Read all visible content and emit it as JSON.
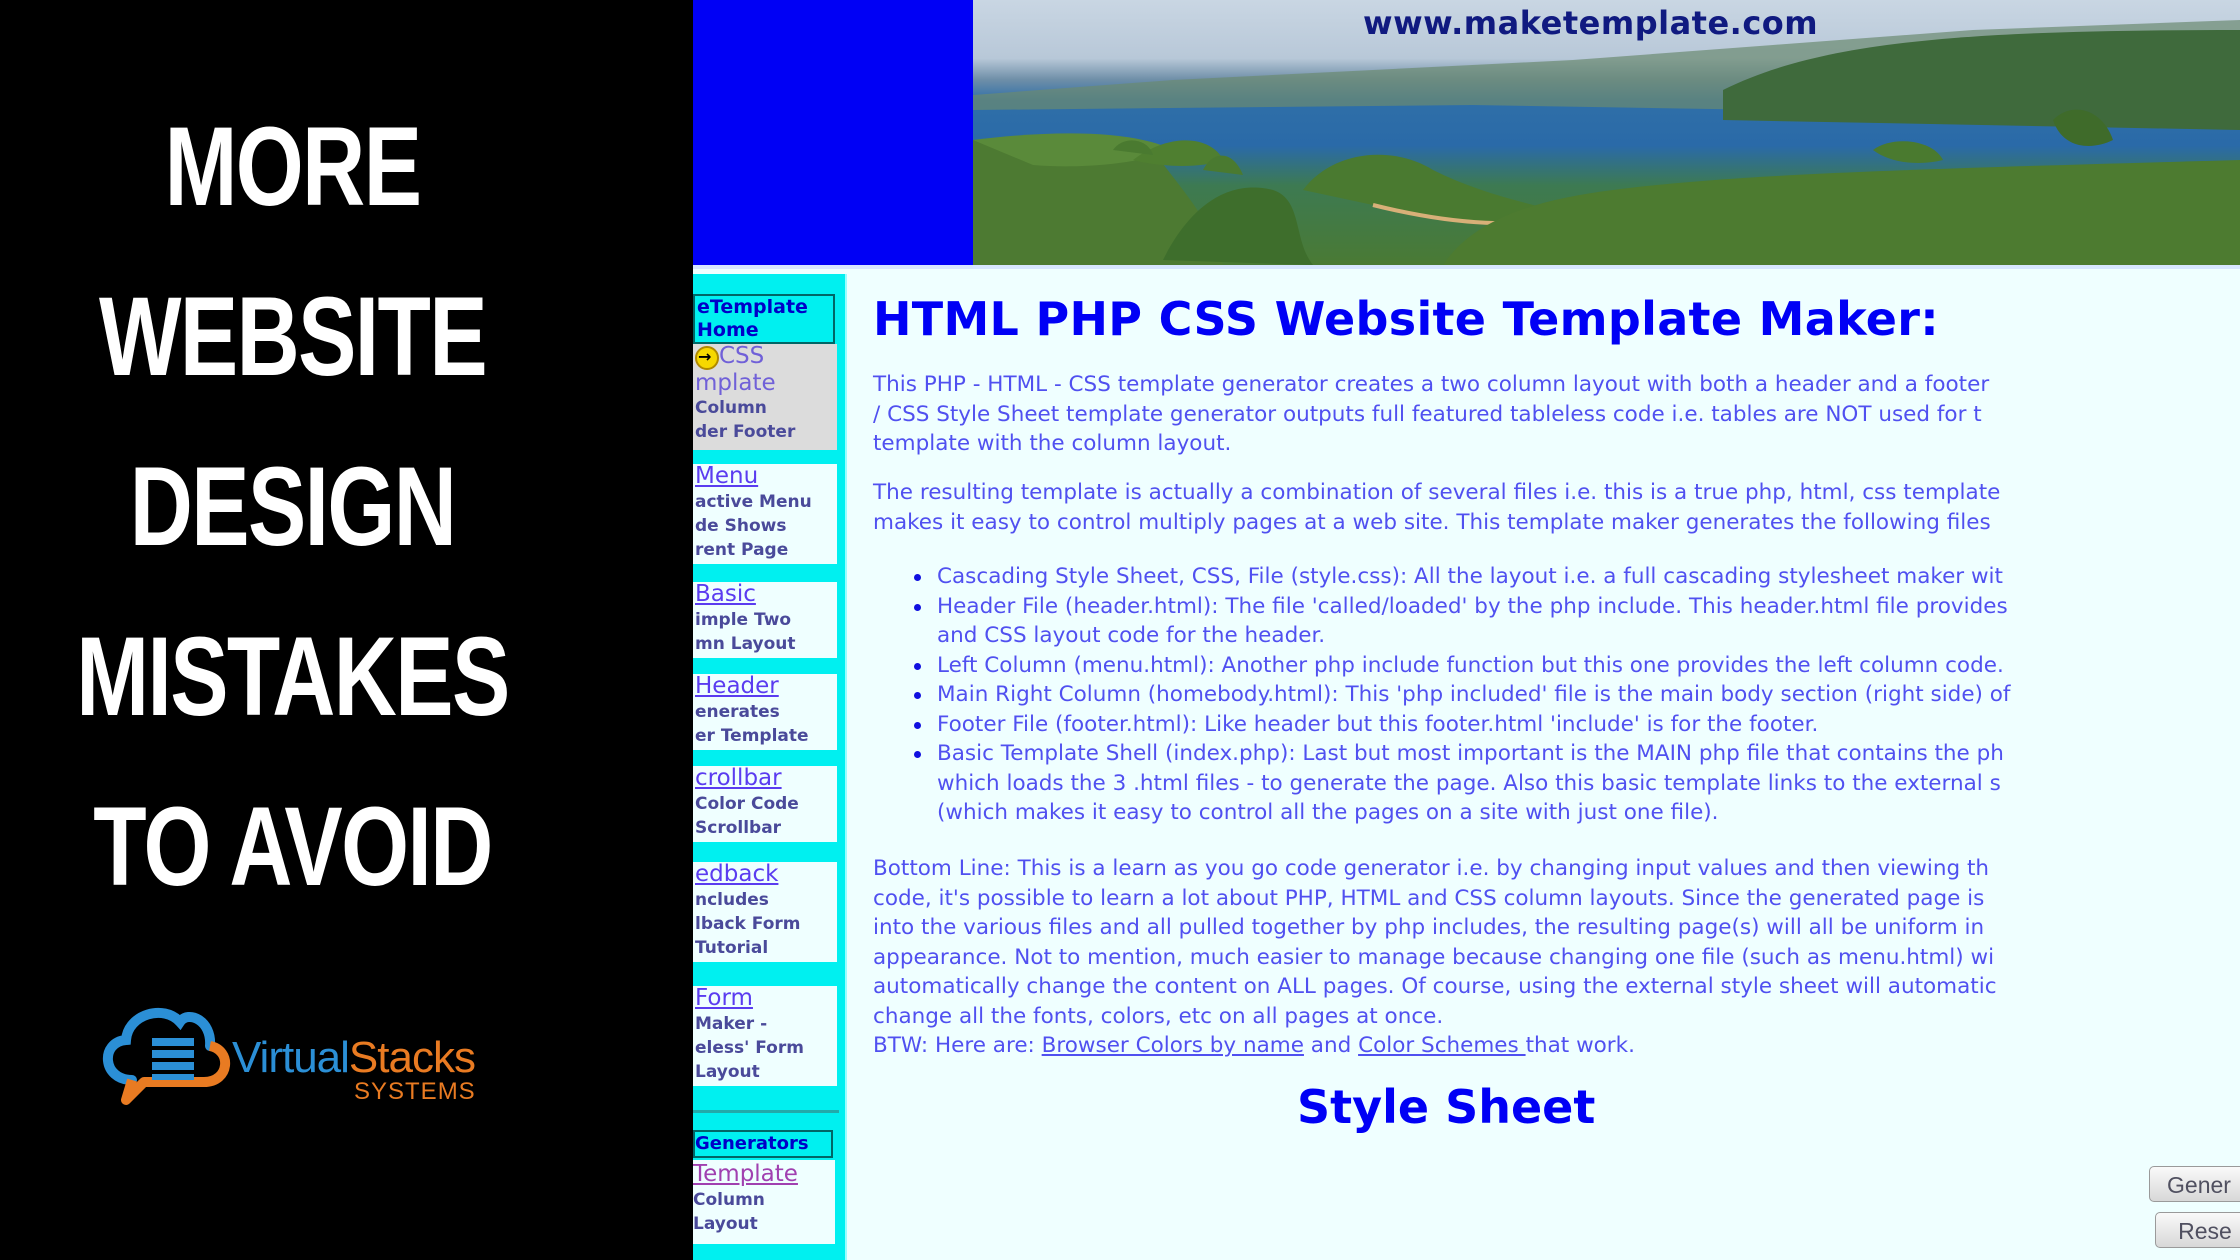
{
  "promo": {
    "title_lines": [
      "MORE",
      "WEBSITE",
      "DESIGN",
      "MISTAKES",
      "TO AVOID"
    ],
    "logo": {
      "word1": "Virtual",
      "word2": "Stacks",
      "sub": "SYSTEMS"
    },
    "colors": {
      "blue": "#2b8fd6",
      "orange": "#e97b22"
    }
  },
  "site": {
    "banner_url": "www.maketemplate.com",
    "sidebar": {
      "header": [
        "eTemplate",
        "Home"
      ],
      "items": [
        {
          "link": "CSS",
          "link2": "mplate",
          "desc": [
            "Column",
            "der Footer"
          ],
          "active": true
        },
        {
          "link": "Menu",
          "desc": [
            "active Menu",
            "de Shows",
            "rent Page"
          ]
        },
        {
          "link": "Basic",
          "desc": [
            "imple Two",
            "mn Layout"
          ]
        },
        {
          "link": "Header",
          "desc": [
            "enerates",
            "er Template"
          ]
        },
        {
          "link": "crollbar",
          "desc": [
            "Color Code",
            "Scrollbar"
          ]
        },
        {
          "link": "edback",
          "desc": [
            "ncludes",
            "lback Form",
            "Tutorial"
          ]
        },
        {
          "link": "Form",
          "desc": [
            "Maker -",
            "eless' Form",
            "Layout"
          ]
        }
      ],
      "generators_header": "Generators",
      "generators_item": {
        "link": "Template",
        "desc": [
          "Column",
          "Layout"
        ]
      }
    },
    "main": {
      "title": "HTML PHP CSS Website Template Maker:",
      "intro_lines": [
        "This PHP - HTML - CSS template generator creates a two column layout with both a header and a footer",
        "/ CSS Style Sheet template generator outputs full featured tableless code i.e. tables are NOT used for t",
        "template with the column layout."
      ],
      "files_lines": [
        "The resulting template is actually a combination of several files i.e. this is a true php, html, css template",
        "makes it easy to control multiply pages at a web site. This template maker generates the following files"
      ],
      "bullets": [
        [
          "Cascading Style Sheet, CSS, File (style.css): All the layout i.e. a full cascading stylesheet maker wit"
        ],
        [
          "Header File (header.html): The file 'called/loaded' by the php include. This header.html file provides",
          "and CSS layout code for the header."
        ],
        [
          "Left Column (menu.html): Another php include function but this one provides the left column code."
        ],
        [
          "Main Right Column (homebody.html): This 'php included' file is the main body section (right side) of"
        ],
        [
          "Footer File (footer.html): Like header but this footer.html 'include' is for the footer."
        ],
        [
          "Basic Template Shell (index.php): Last but most important is the MAIN php file that contains the ph",
          "which loads the 3 .html files - to generate the page. Also this basic template links to the external s",
          "(which makes it easy to control all the pages on a site with just one file)."
        ]
      ],
      "bottom_lines": [
        "Bottom Line: This is a learn as you go code generator i.e. by changing input values and then viewing th",
        "code, it's possible to learn a lot about PHP, HTML and CSS column layouts. Since the generated page is",
        "into the various files and all pulled together by php includes, the resulting page(s) will all be uniform in",
        "appearance. Not to mention, much easier to manage because changing one file (such as menu.html) wi",
        "automatically change the content on ALL pages. Of course, using the external style sheet will automatic",
        "change all the fonts, colors, etc on all pages at once."
      ],
      "btw": {
        "prefix": "BTW: Here are: ",
        "link1": "Browser Colors by name",
        "middle": " and ",
        "link2": "Color Schemes ",
        "suffix": "that work."
      },
      "section_title": "Style Sheet",
      "buttons": {
        "generate": "Gener",
        "reset": "Rese"
      }
    },
    "colors": {
      "header_blue": "#0000f5",
      "sidebar_cyan": "#00f0f0",
      "page_bg": "#efffff",
      "text_blue": "#5050f0"
    }
  }
}
